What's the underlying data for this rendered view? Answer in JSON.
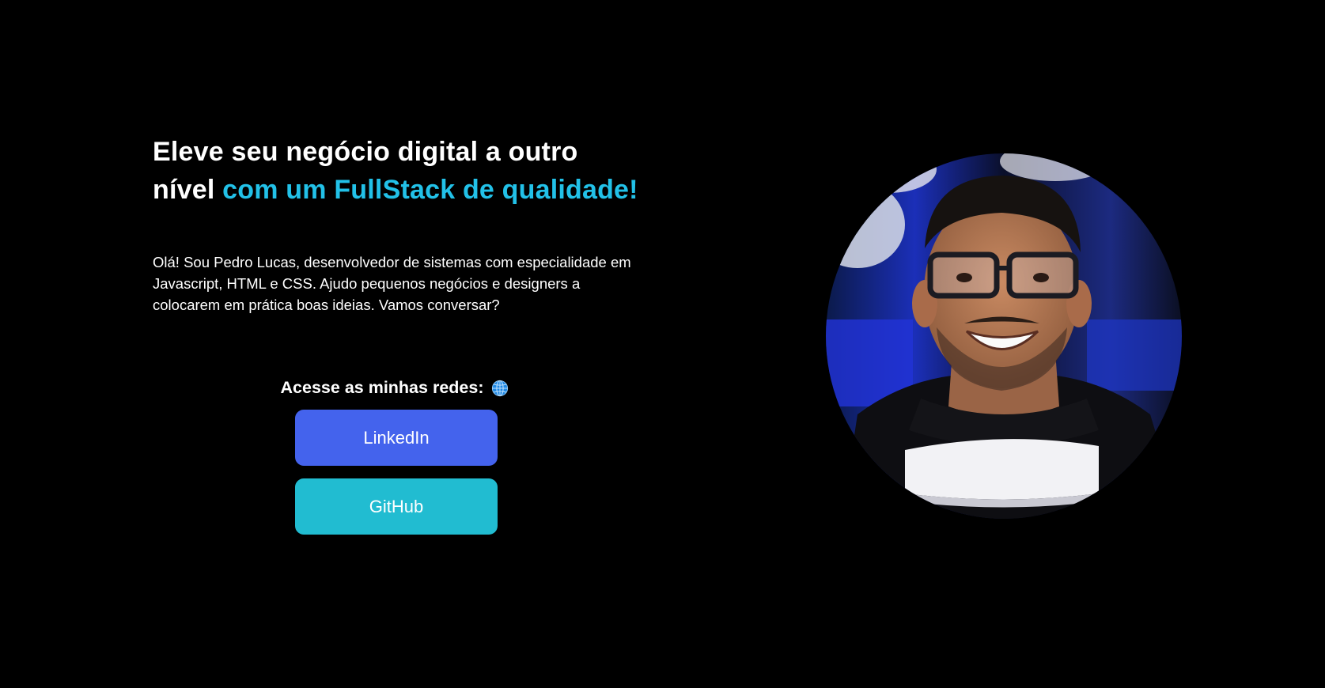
{
  "hero": {
    "headline_plain": "Eleve seu negócio digital a outro nível ",
    "headline_accent": "com um FullStack de qualidade!",
    "bio": "Olá! Sou Pedro Lucas, desenvolvedor de sistemas com especialidade em Javascript, HTML e CSS. Ajudo pequenos negócios e designers a colocarem em prática boas ideias. Vamos conversar?"
  },
  "networks": {
    "title": "Acesse as minhas redes:",
    "title_icon": "globe-icon",
    "buttons": [
      {
        "label": "LinkedIn",
        "color": "#4463ed"
      },
      {
        "label": "GitHub",
        "color": "#21bcd1"
      }
    ]
  },
  "avatar": {
    "description_icon": "profile-photo"
  },
  "colors": {
    "background": "#000000",
    "text": "#ffffff",
    "accent": "#22c1e8"
  }
}
